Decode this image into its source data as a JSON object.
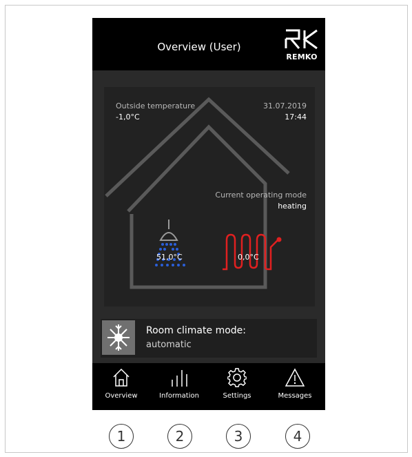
{
  "header": {
    "title": "Overview (User)",
    "logo_text": "REMKO"
  },
  "status": {
    "outside_label": "Outside temperature",
    "outside_value": "-1,0°C",
    "date": "31.07.2019",
    "time": "17:44",
    "mode_label": "Current operating mode",
    "mode_value": "heating"
  },
  "widgets": {
    "hot_water_temp": "51,0°C",
    "heating_temp": "0,0°C"
  },
  "room_climate": {
    "label": "Room climate mode:",
    "value": "automatic"
  },
  "nav": [
    {
      "label": "Overview",
      "icon": "home-icon"
    },
    {
      "label": "Information",
      "icon": "bars-icon"
    },
    {
      "label": "Settings",
      "icon": "gear-icon"
    },
    {
      "label": "Messages",
      "icon": "warning-icon"
    }
  ],
  "callouts": [
    "1",
    "2",
    "3",
    "4"
  ],
  "colors": {
    "accent_red": "#e02020",
    "water_blue": "#2b5fd9",
    "background": "#2a2a2a"
  }
}
